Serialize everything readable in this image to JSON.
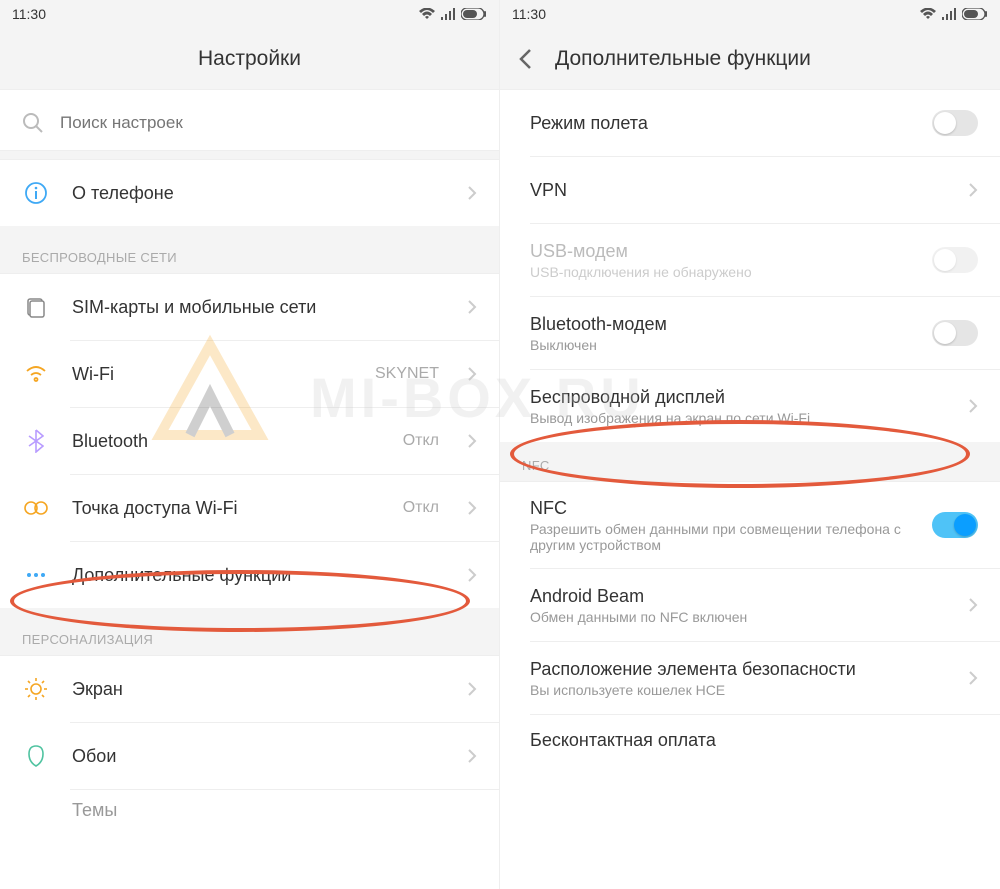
{
  "statusbar": {
    "time": "11:30"
  },
  "left": {
    "title": "Настройки",
    "search_placeholder": "Поиск настроек",
    "about": "О телефоне",
    "section_wireless": "БЕСПРОВОДНЫЕ СЕТИ",
    "sim": "SIM-карты и мобильные сети",
    "wifi": {
      "label": "Wi-Fi",
      "value": "SKYNET"
    },
    "bt": {
      "label": "Bluetooth",
      "value": "Откл"
    },
    "hotspot": {
      "label": "Точка доступа Wi-Fi",
      "value": "Откл"
    },
    "more": "Дополнительные функции",
    "section_personal": "ПЕРСОНАЛИЗАЦИЯ",
    "display": "Экран",
    "wallpaper": "Обои",
    "themes": "Темы"
  },
  "right": {
    "title": "Дополнительные функции",
    "airplane": "Режим полета",
    "vpn": "VPN",
    "usb": {
      "label": "USB-модем",
      "sub": "USB-подключения не обнаружено"
    },
    "btt": {
      "label": "Bluetooth-модем",
      "sub": "Выключен"
    },
    "wdisp": {
      "label": "Беспроводной дисплей",
      "sub": "Вывод изображения на экран по сети Wi-Fi"
    },
    "section_nfc": "NFC",
    "nfc": {
      "label": "NFC",
      "sub": "Разрешить обмен данными при совмещении телефона с другим устройством"
    },
    "beam": {
      "label": "Android Beam",
      "sub": "Обмен данными по NFC включен"
    },
    "sec": {
      "label": "Расположение элемента безопасности",
      "sub": "Вы используете кошелек HCE"
    },
    "pay": "Бесконтактная оплата"
  },
  "watermark": "MI-BOX RU"
}
